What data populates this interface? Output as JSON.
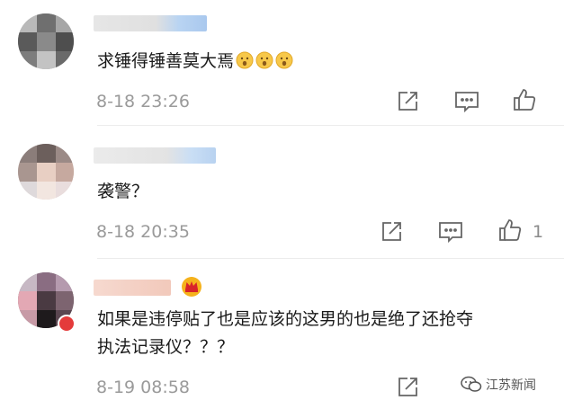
{
  "comments": [
    {
      "text": "求锤得锤善莫大焉",
      "emoji_icon": "hushed-face-emoji-icon",
      "time": "8-18 23:26",
      "like_count": ""
    },
    {
      "text": "袭警？",
      "time": "8-18 20:35",
      "like_count": "1"
    },
    {
      "text_line1": "如果是违停贴了也是应该的这男的也是绝了还抢夺",
      "text_line2": "执法记录仪？？？",
      "time": "8-19 08:58",
      "badge_icon": "crown-badge-icon"
    }
  ],
  "watermark": {
    "label": "江苏新闻",
    "icon": "wechat-icon"
  },
  "icons": {
    "share": "share-icon",
    "comment": "comment-icon",
    "like": "thumbs-up-icon"
  },
  "colors": {
    "text": "#1a1a1a",
    "meta": "#9a9a9a",
    "icon": "#666666"
  }
}
